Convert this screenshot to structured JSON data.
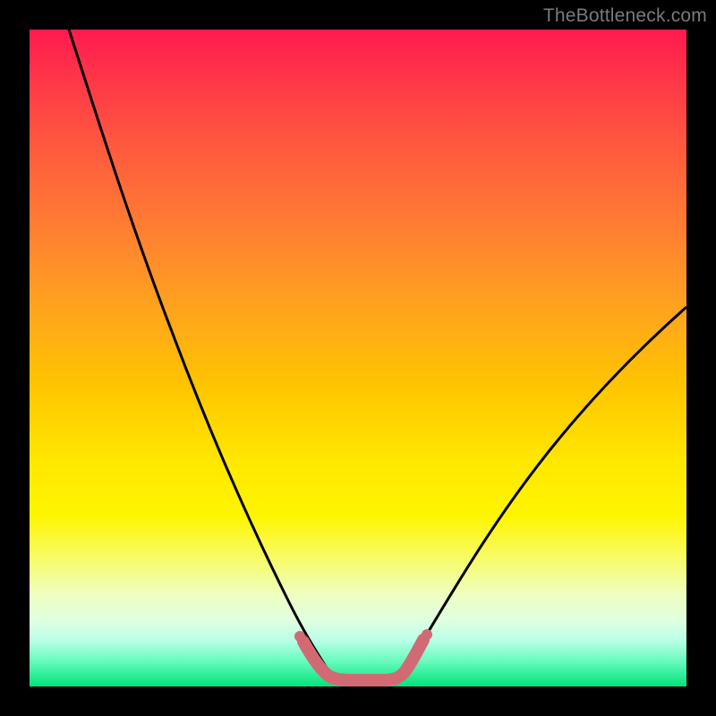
{
  "watermark": "TheBottleneck.com",
  "chart_data": {
    "type": "line",
    "title": "",
    "xlabel": "",
    "ylabel": "",
    "xlim": [
      0,
      100
    ],
    "ylim": [
      0,
      100
    ],
    "series": [
      {
        "name": "black-curve-left",
        "x": [
          6,
          10,
          15,
          20,
          25,
          30,
          35,
          38,
          40,
          42,
          44
        ],
        "y": [
          100,
          88,
          74,
          59,
          44,
          30,
          17,
          10,
          6,
          3,
          1
        ]
      },
      {
        "name": "black-curve-right",
        "x": [
          56,
          58,
          62,
          68,
          75,
          82,
          90,
          100
        ],
        "y": [
          1,
          3,
          8,
          17,
          28,
          38,
          48,
          58
        ]
      },
      {
        "name": "pink-highlight",
        "x": [
          40,
          42,
          44,
          46,
          50,
          54,
          56,
          58
        ],
        "y": [
          6,
          3,
          1.2,
          0.8,
          0.8,
          0.8,
          1.2,
          3
        ]
      }
    ],
    "colors": {
      "curve": "#000000",
      "highlight": "#d26a74",
      "gradient_top": "#ff1a4f",
      "gradient_bottom": "#00e47a"
    }
  }
}
